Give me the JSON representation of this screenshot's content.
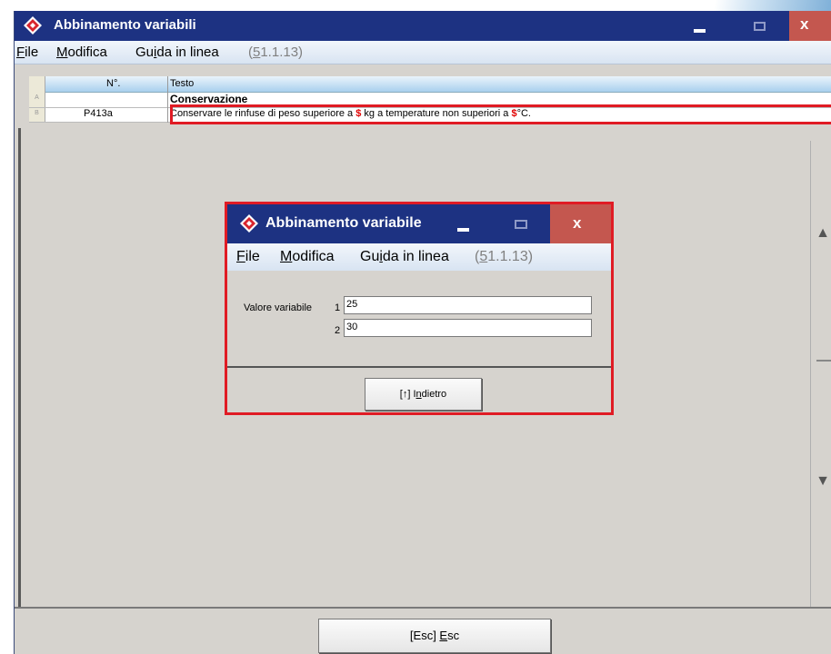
{
  "main_window": {
    "title": "Abbinamento variabili",
    "menu": [
      {
        "pre": "",
        "ul": "F",
        "post": "ile"
      },
      {
        "pre": "",
        "ul": "M",
        "post": "odifica"
      },
      {
        "pre": "Gu",
        "ul": "i",
        "post": "da in linea"
      }
    ],
    "version": {
      "pre": "(",
      "ul": "5",
      "post": "1.1.13)"
    },
    "grid": {
      "headers": [
        "N°.",
        "Testo"
      ],
      "rows": [
        {
          "marker": "A",
          "num": "",
          "text": "Conservazione",
          "bold": true
        },
        {
          "marker": "B",
          "num": "P413a",
          "text_parts": [
            "Conservare le rinfuse di peso superiore a ",
            "$",
            " kg a temperature non superiori a ",
            "$",
            "°C."
          ]
        }
      ]
    },
    "footer_button": {
      "pre": "[Esc] ",
      "ul": "E",
      "post": "sc"
    },
    "accent_color": "#1d3282",
    "close_color": "#c4574f",
    "highlight_color": "#e01b24"
  },
  "dialog": {
    "title": "Abbinamento variabile",
    "menu": [
      {
        "pre": "",
        "ul": "F",
        "post": "ile"
      },
      {
        "pre": "",
        "ul": "M",
        "post": "odifica"
      },
      {
        "pre": "Gu",
        "ul": "i",
        "post": "da in linea"
      }
    ],
    "version": {
      "pre": "(",
      "ul": "5",
      "post": "1.1.13)"
    },
    "field_label": "Valore variabile",
    "fields": [
      {
        "index": "1",
        "value": "25"
      },
      {
        "index": "2",
        "value": "30"
      }
    ],
    "back_button": {
      "pre": "[↑] I",
      "ul": "n",
      "post": "dietro"
    }
  },
  "icons": [
    "app-diamond-icon",
    "minimize-icon",
    "maximize-icon",
    "close-icon",
    "scroll-up-icon",
    "scroll-down-icon"
  ]
}
